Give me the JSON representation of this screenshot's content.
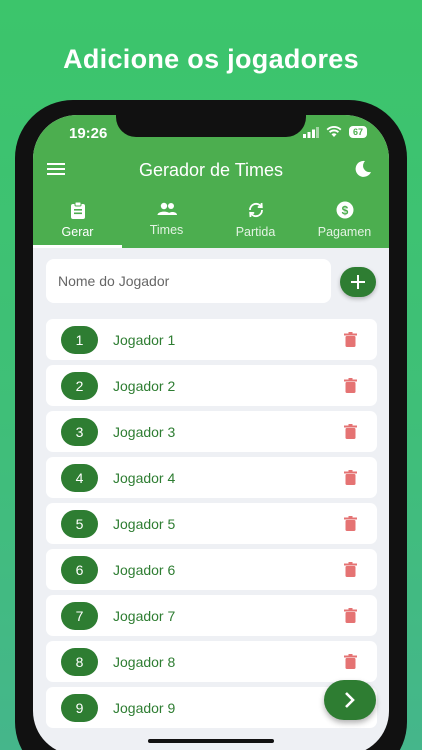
{
  "headline": "Adicione os jogadores",
  "status_bar": {
    "time": "19:26",
    "battery": "67"
  },
  "app_bar": {
    "title": "Gerador de Times"
  },
  "tabs": [
    {
      "label": "Gerar",
      "icon": "clipboard-icon",
      "active": true
    },
    {
      "label": "Times",
      "icon": "group-icon",
      "active": false
    },
    {
      "label": "Partida",
      "icon": "sync-icon",
      "active": false
    },
    {
      "label": "Pagamen",
      "icon": "dollar-icon",
      "active": false
    }
  ],
  "player_input": {
    "placeholder": "Nome do Jogador",
    "value": ""
  },
  "players": [
    {
      "number": "1",
      "name": "Jogador 1"
    },
    {
      "number": "2",
      "name": "Jogador 2"
    },
    {
      "number": "3",
      "name": "Jogador 3"
    },
    {
      "number": "4",
      "name": "Jogador 4"
    },
    {
      "number": "5",
      "name": "Jogador 5"
    },
    {
      "number": "6",
      "name": "Jogador 6"
    },
    {
      "number": "7",
      "name": "Jogador 7"
    },
    {
      "number": "8",
      "name": "Jogador 8"
    },
    {
      "number": "9",
      "name": "Jogador 9"
    }
  ],
  "colors": {
    "primary": "#4cae4f",
    "dark_green": "#2e7d32",
    "delete": "#e57373",
    "background": "#eef0f4"
  }
}
